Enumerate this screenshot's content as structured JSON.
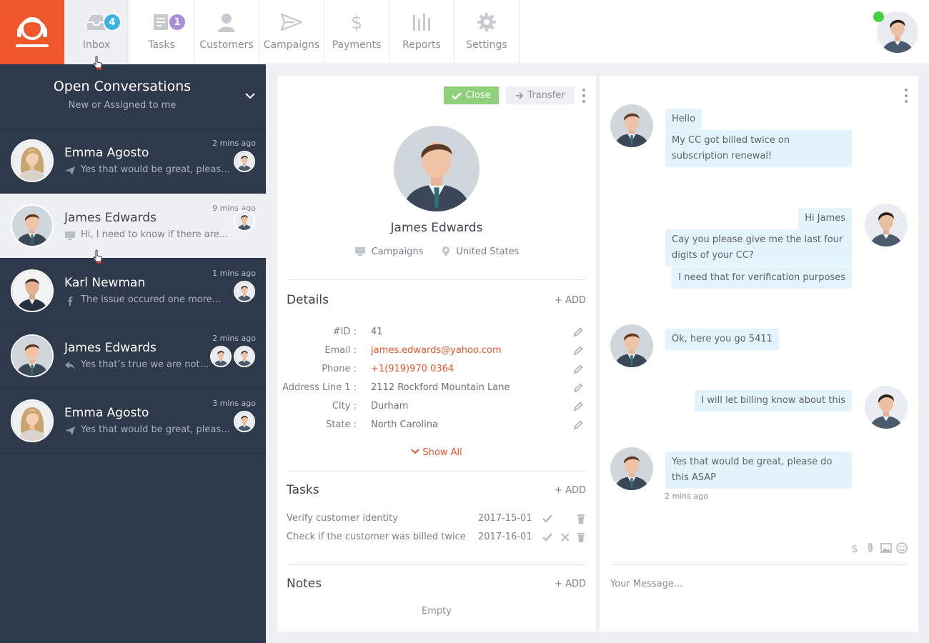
{
  "nav": {
    "items": [
      {
        "label": "Inbox",
        "icon": "inbox-icon",
        "badge": "4",
        "badge_color": "#3fb3e0"
      },
      {
        "label": "Tasks",
        "icon": "tasks-icon",
        "badge": "1",
        "badge_color": "#a98fd8"
      },
      {
        "label": "Customers",
        "icon": "customers-icon"
      },
      {
        "label": "Campaigns",
        "icon": "campaigns-icon"
      },
      {
        "label": "Payments",
        "icon": "payments-icon"
      },
      {
        "label": "Reports",
        "icon": "reports-icon"
      },
      {
        "label": "Settings",
        "icon": "settings-icon"
      }
    ],
    "user_status": "online",
    "brand_color": "#f0572a"
  },
  "sidebar": {
    "title": "Open Conversations",
    "subtitle": "New or Assigned to me",
    "conversations": [
      {
        "name": "Emma Agosto",
        "preview": "Yes that would be great, please...",
        "time": "2 mins ago",
        "channel_icon": "send-icon"
      },
      {
        "name": "James Edwards",
        "preview": "Hi, I need to know if there are...",
        "time": "9 mins ago",
        "channel_icon": "monitor-icon",
        "selected": true
      },
      {
        "name": "Karl Newman",
        "preview": "The issue occured one more...",
        "time": "1 mins ago",
        "channel_icon": "facebook-icon"
      },
      {
        "name": "James Edwards",
        "preview": "Yes that’s true we are not...",
        "time": "2 mins ago",
        "channel_icon": "reply-icon"
      },
      {
        "name": "Emma Agosto",
        "preview": "Yes that would be great, please...",
        "time": "3 mins ago",
        "channel_icon": "send-icon"
      }
    ]
  },
  "customer": {
    "close_label": "Close",
    "transfer_label": "Transfer",
    "name": "James Edwards",
    "source": "Campaigns",
    "location": "United States",
    "details_title": "Details",
    "add_label": "+ ADD",
    "details": [
      {
        "label": "#ID :",
        "value": "41"
      },
      {
        "label": "Email :",
        "value": "james.edwards@yahoo.com",
        "link": true
      },
      {
        "label": "Phone :",
        "value": "+1(919)970 0364",
        "link": true
      },
      {
        "label": "Address Line 1 :",
        "value": "2112 Rockford Mountain Lane"
      },
      {
        "label": "CIty :",
        "value": "Durham"
      },
      {
        "label": "State :",
        "value": "North Carolina"
      }
    ],
    "show_all": "Show All",
    "tasks_title": "Tasks",
    "tasks": [
      {
        "name": "Verify customer identity",
        "date": "2017-15-01"
      },
      {
        "name": "Check if the customer was billed twice",
        "date": "2017-16-01"
      }
    ],
    "notes_title": "Notes",
    "notes_empty": "Empty"
  },
  "chat": {
    "messages": [
      {
        "from": "customer",
        "lines": [
          "Hello",
          "My CC got billed twice on subscription renewal!"
        ]
      },
      {
        "from": "agent",
        "lines": [
          "Hi James",
          "Cay you please give me the last four digits of your CC?",
          "I need that for verification purposes"
        ]
      },
      {
        "from": "customer",
        "lines": [
          "Ok, here you go 5411"
        ]
      },
      {
        "from": "agent",
        "lines": [
          "I will let billing know about this"
        ]
      },
      {
        "from": "customer",
        "lines": [
          "Yes that would be great, please do this  ASAP"
        ]
      }
    ],
    "last_time": "2 mins ago",
    "placeholder": "Your Message..."
  },
  "colors": {
    "accent": "#e8542b",
    "success": "#8fd07a",
    "sidebar_bg": "#2e3a4b",
    "bubble_bg": "#e4f4fc"
  }
}
